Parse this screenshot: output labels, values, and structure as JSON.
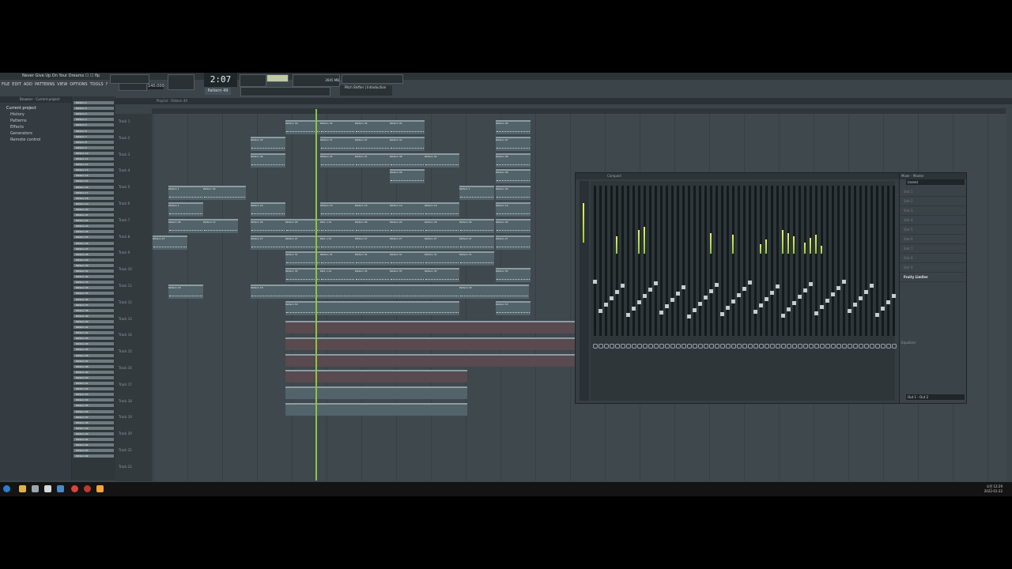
{
  "title": "Never Give Up On Your Dreams ☐ ☐ flp",
  "menu": [
    "FILE",
    "EDIT",
    "ADD",
    "PATTERNS",
    "VIEW",
    "OPTIONS",
    "TOOLS",
    "?"
  ],
  "transport": {
    "time": "2:07",
    "subtime": "25",
    "tempo": "140.000",
    "pattern": "Pattern 49",
    "hint": "Pitch Shifter | Introduction",
    "cpu": "2645 MB"
  },
  "browser": {
    "header": "Browser - Current project",
    "root": "Current project",
    "items": [
      "History",
      "Patterns",
      "Effects",
      "Generators",
      "Remote control"
    ]
  },
  "playlist": {
    "header": "Playlist - Pattern 49"
  },
  "tracks": [
    "Track 1",
    "Track 2",
    "Track 3",
    "Track 4",
    "Track 5",
    "Track 6",
    "Track 7",
    "Track 8",
    "Track 9",
    "Track 10",
    "Track 11",
    "Track 12",
    "Track 13",
    "Track 14",
    "Track 15",
    "Track 16",
    "Track 17",
    "Track 18",
    "Track 19",
    "Track 20",
    "Track 21",
    "Track 22"
  ],
  "channels": [
    "Pattern 1",
    "Pattern 2",
    "Pattern 3",
    "Pattern 4",
    "Pattern 5",
    "Pattern 6",
    "Pattern 7",
    "Pattern 8",
    "Pattern 9",
    "Pattern 10",
    "Pattern 11",
    "Pattern 12",
    "Pattern 13",
    "Pattern 14",
    "Pattern 15",
    "Pattern 16",
    "Pattern 17",
    "Pattern 18",
    "Pattern 19",
    "Pattern 20",
    "Pattern 21",
    "Pattern 22",
    "Pattern 23",
    "Pattern 24",
    "Pattern 25",
    "Pattern 26",
    "Pattern 27",
    "Pattern 28",
    "Pattern 29",
    "Pattern 30",
    "Pattern 31",
    "Pattern 32",
    "Pattern 33",
    "Pattern 34",
    "Pattern 35",
    "Pattern 36",
    "Pattern 37",
    "Pattern 38",
    "Pattern 39",
    "Pattern 40",
    "Pattern 41",
    "Pattern 42",
    "Pattern 43",
    "Pattern 44",
    "Pattern 45",
    "Pattern 46",
    "Pattern 47",
    "Pattern 48",
    "Pattern 49",
    "Pattern 50",
    "Pattern 51",
    "Pattern 52",
    "Pattern 53",
    "Pattern 54",
    "Pattern 55",
    "Pattern 56",
    "Pattern 57",
    "Pattern 58",
    "Pattern 59",
    "Pattern 60",
    "Pattern 61",
    "Pattern 62",
    "Pattern 63",
    "Pattern 64"
  ],
  "clip_labels": [
    "Pattern 29",
    "Pattern 34",
    "Pattern 44",
    "Pattern 45",
    "Pattern 46",
    "Pattern 33",
    "Pattern 37",
    "Pattern 47",
    "Pattern 32",
    "Pattern 36",
    "Pattern 42",
    "Pattern 41",
    "Pattern 38",
    "Pattern 48",
    "Pattern 1",
    "Pattern 30",
    "Pattern 19",
    "Pattern 26",
    "Pattern 27",
    "Pattern 12",
    "Pattern 31",
    "Pattern 35",
    "Patt..n 41",
    "Pattern 18",
    "Pattern 53"
  ],
  "mixer": {
    "header": "Compact",
    "fx_header": "Mixer - Master",
    "preset": "(none)",
    "slots": [
      "Slot 1",
      "Slot 2",
      "Slot 3",
      "Slot 4",
      "Slot 5",
      "Slot 6",
      "Slot 7",
      "Slot 8",
      "Slot 9"
    ],
    "active_slot": "Fruity Limiter",
    "equalizer": "Equalizer",
    "output": "Out 1 - Out 2"
  },
  "tray": {
    "time": "오전 12:29",
    "date": "2022-01-22",
    "lang": "A"
  }
}
